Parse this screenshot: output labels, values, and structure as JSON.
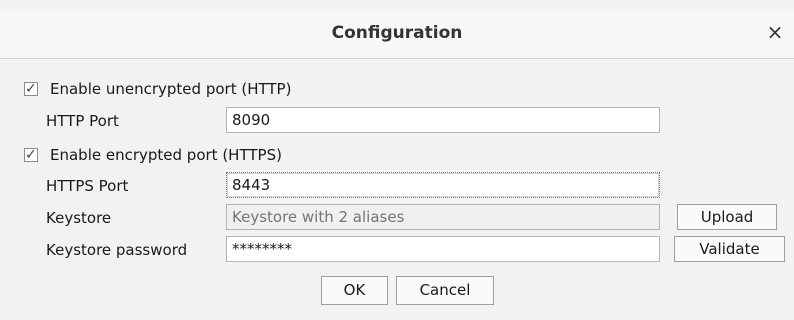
{
  "dialog": {
    "title": "Configuration",
    "close_glyph": "×"
  },
  "http": {
    "checkbox_label": "Enable unencrypted port (HTTP)",
    "checked": true,
    "port_label": "HTTP Port",
    "port_value": "8090"
  },
  "https": {
    "checkbox_label": "Enable encrypted port (HTTPS)",
    "checked": true,
    "port_label": "HTTPS Port",
    "port_value": "8443",
    "keystore_label": "Keystore",
    "keystore_placeholder": "Keystore with 2 aliases",
    "upload_label": "Upload",
    "password_label": "Keystore password",
    "password_value": "********",
    "validate_label": "Validate"
  },
  "footer": {
    "ok_label": "OK",
    "cancel_label": "Cancel"
  },
  "icons": {
    "close": "close-icon",
    "check": "checkmark-icon"
  }
}
